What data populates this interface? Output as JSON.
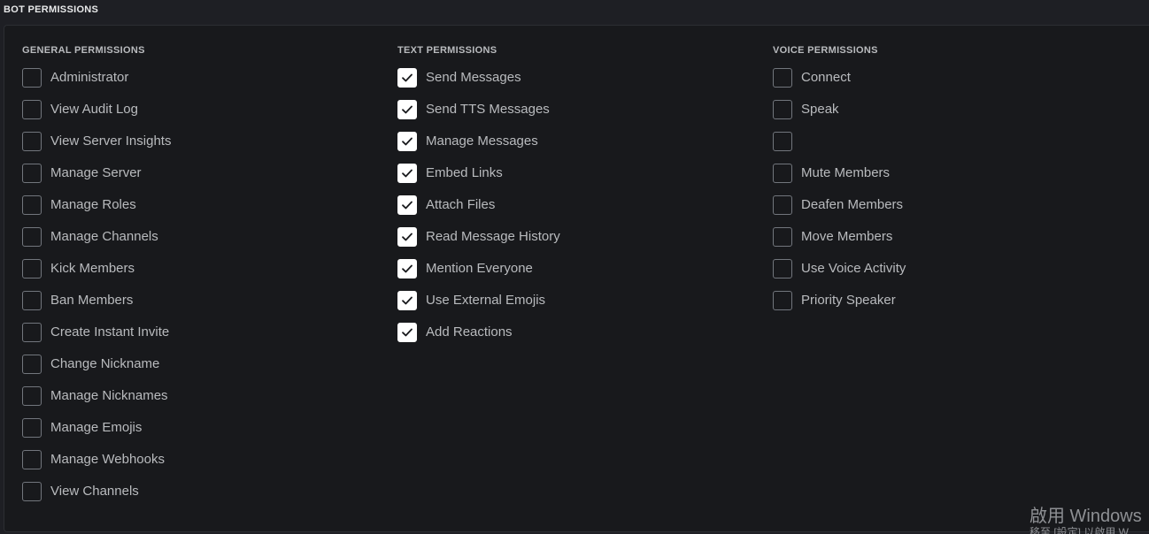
{
  "section_title": "BOT PERMISSIONS",
  "columns": [
    {
      "title": "GENERAL PERMISSIONS",
      "items": [
        {
          "label": "Administrator",
          "checked": false
        },
        {
          "label": "View Audit Log",
          "checked": false
        },
        {
          "label": "View Server Insights",
          "checked": false
        },
        {
          "label": "Manage Server",
          "checked": false
        },
        {
          "label": "Manage Roles",
          "checked": false
        },
        {
          "label": "Manage Channels",
          "checked": false
        },
        {
          "label": "Kick Members",
          "checked": false
        },
        {
          "label": "Ban Members",
          "checked": false
        },
        {
          "label": "Create Instant Invite",
          "checked": false
        },
        {
          "label": "Change Nickname",
          "checked": false
        },
        {
          "label": "Manage Nicknames",
          "checked": false
        },
        {
          "label": "Manage Emojis",
          "checked": false
        },
        {
          "label": "Manage Webhooks",
          "checked": false
        },
        {
          "label": "View Channels",
          "checked": false
        }
      ]
    },
    {
      "title": "TEXT PERMISSIONS",
      "items": [
        {
          "label": "Send Messages",
          "checked": true
        },
        {
          "label": "Send TTS Messages",
          "checked": true
        },
        {
          "label": "Manage Messages",
          "checked": true
        },
        {
          "label": "Embed Links",
          "checked": true
        },
        {
          "label": "Attach Files",
          "checked": true
        },
        {
          "label": "Read Message History",
          "checked": true
        },
        {
          "label": "Mention Everyone",
          "checked": true
        },
        {
          "label": "Use External Emojis",
          "checked": true
        },
        {
          "label": "Add Reactions",
          "checked": true
        }
      ]
    },
    {
      "title": "VOICE PERMISSIONS",
      "items": [
        {
          "label": "Connect",
          "checked": false
        },
        {
          "label": "Speak",
          "checked": false
        },
        {
          "label": "",
          "checked": false
        },
        {
          "label": "Mute Members",
          "checked": false
        },
        {
          "label": "Deafen Members",
          "checked": false
        },
        {
          "label": "Move Members",
          "checked": false
        },
        {
          "label": "Use Voice Activity",
          "checked": false
        },
        {
          "label": "Priority Speaker",
          "checked": false
        }
      ]
    }
  ],
  "watermark": {
    "line1": "啟用 Windows",
    "line2": "移至 [設定] 以啟用 W"
  },
  "colors": {
    "background": "#1e1f24",
    "panel": "#18191c",
    "checkbox_border": "#72767d",
    "checkbox_checked": "#ffffff",
    "label": "#b9bbbe"
  },
  "icons": {
    "checked": "check-icon"
  }
}
